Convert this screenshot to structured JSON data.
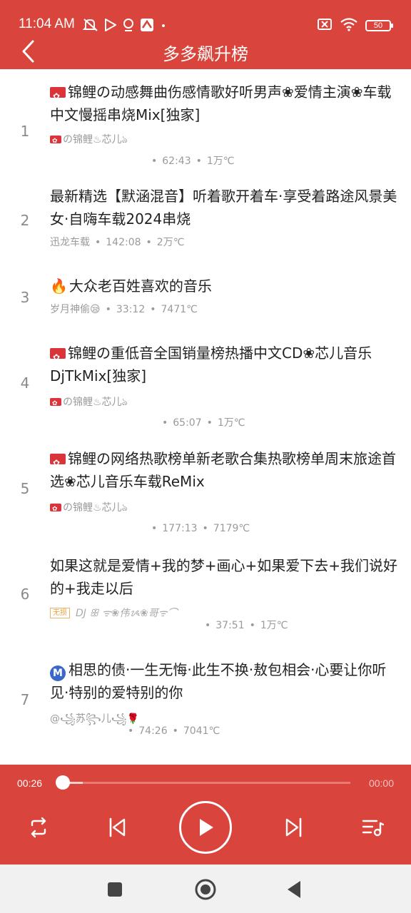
{
  "status_bar": {
    "time": "11:04 AM",
    "battery": "50"
  },
  "header": {
    "title": "多多飙升榜"
  },
  "songs": [
    {
      "rank": "1",
      "title": "锦鲤の动感舞曲伤感情歌好听男声❀爱情主演❀车载中文慢摇串烧Mix[独家]",
      "artist": "の锦鲤♨芯儿ঌ",
      "duration": "62:43",
      "heat": "1万℃"
    },
    {
      "rank": "2",
      "title": "最新精选【默涵混音】听着歌开着车·享受着路途风景美女·自嗨车载2024串烧",
      "artist": "迅龙车载",
      "duration": "142:08",
      "heat": "2万℃"
    },
    {
      "rank": "3",
      "title": "大众老百姓喜欢的音乐",
      "artist": "岁月神偷😪",
      "duration": "33:12",
      "heat": "7471℃"
    },
    {
      "rank": "4",
      "title": "锦鲤の重低音全国销量榜热播中文CD❀芯儿音乐DjTkMix[独家]",
      "artist": "の锦鲤♨芯儿ঌ",
      "duration": "65:07",
      "heat": "1万℃"
    },
    {
      "rank": "5",
      "title": "锦鲤の网络热歌榜单新老歌合集热歌榜单周末旅途首选❀芯儿音乐车载ReMix",
      "artist": "の锦鲤♨芯儿ঌ",
      "duration": "177:13",
      "heat": "7179℃"
    },
    {
      "rank": "6",
      "title": "如果这就是爱情+我的梦+画心+如果爱下去+我们说好的+我走以后",
      "badge": "无损",
      "artist": "DJ ꕥ ᯤ❀伟ᝰ❀哥ᯤ⌒",
      "duration": "37:51",
      "heat": "1万℃"
    },
    {
      "rank": "7",
      "title": "相思的债·一生无悔·此生不换·敖包相会·心要让你听见·特别的爱特别的你",
      "artist": "@꧁苏꧂儿꧁🌹",
      "duration": "74:26",
      "heat": "7041℃"
    }
  ],
  "player": {
    "current_time": "00:26",
    "end_time": "00:00",
    "progress": 0.07
  },
  "colors": {
    "accent": "#d9443c",
    "meta": "#9a9a9a",
    "rank": "#8a8a8a"
  }
}
